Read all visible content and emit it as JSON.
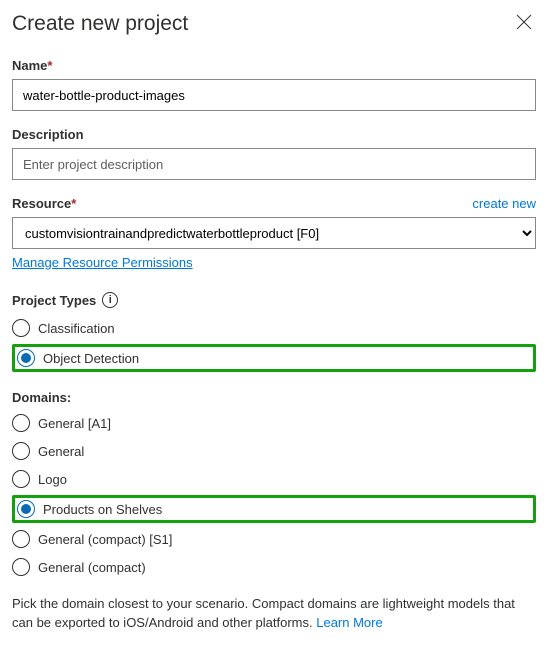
{
  "header": {
    "title": "Create new project"
  },
  "name": {
    "label": "Name",
    "value": "water-bottle-product-images"
  },
  "description": {
    "label": "Description",
    "placeholder": "Enter project description"
  },
  "resource": {
    "label": "Resource",
    "create_link": "create new",
    "selected": "customvisiontrainandpredictwaterbottleproduct [F0]",
    "manage_link": "Manage Resource Permissions"
  },
  "project_types": {
    "label": "Project Types",
    "options": {
      "classification": "Classification",
      "object_detection": "Object Detection"
    }
  },
  "domains": {
    "label": "Domains:",
    "options": {
      "general_a1": "General [A1]",
      "general": "General",
      "logo": "Logo",
      "products_on_shelves": "Products on Shelves",
      "general_compact_s1": "General (compact) [S1]",
      "general_compact": "General (compact)"
    },
    "help": "Pick the domain closest to your scenario. Compact domains are lightweight models that can be exported to iOS/Android and other platforms. ",
    "learn_more": "Learn More"
  }
}
